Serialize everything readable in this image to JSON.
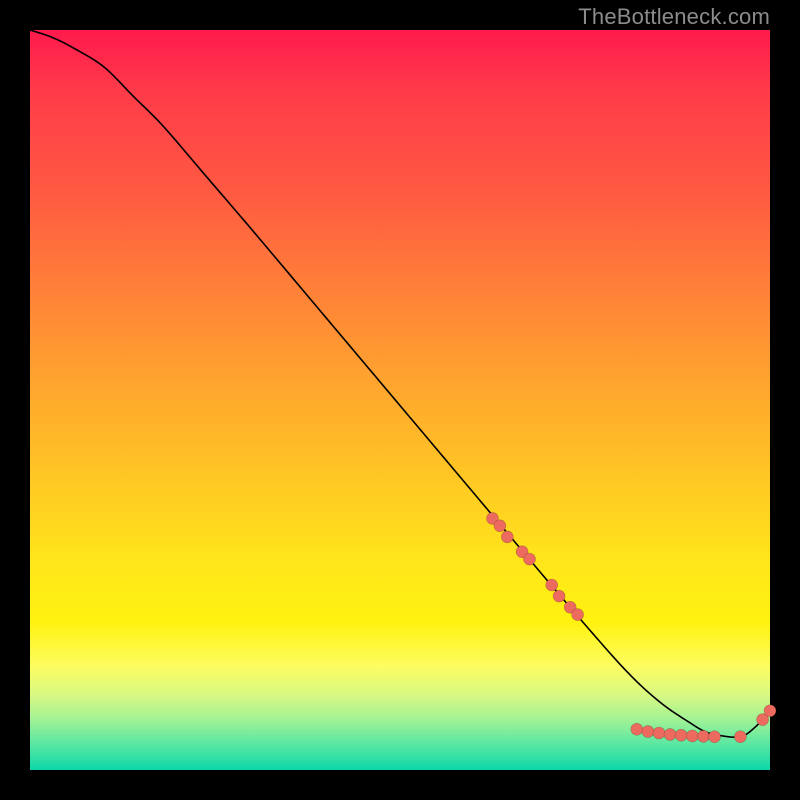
{
  "watermark": "TheBottleneck.com",
  "colors": {
    "background": "#000000",
    "curve": "#000000",
    "marker": "#ec6b5e"
  },
  "chart_data": {
    "type": "line",
    "title": "",
    "xlabel": "",
    "ylabel": "",
    "xlim": [
      0,
      100
    ],
    "ylim": [
      0,
      100
    ],
    "grid": false,
    "legend": false,
    "series": [
      {
        "name": "curve",
        "x": [
          0,
          3,
          6,
          10,
          14,
          18,
          24,
          30,
          38,
          46,
          54,
          62,
          70,
          76,
          80,
          83,
          86,
          89,
          91,
          93,
          96,
          98,
          100
        ],
        "y": [
          100,
          99,
          97.5,
          95,
          91,
          87,
          80,
          73,
          63.5,
          54,
          44.5,
          35,
          25.5,
          18.5,
          14,
          11,
          8.5,
          6.5,
          5.3,
          4.7,
          4.5,
          5.8,
          8
        ]
      }
    ],
    "markers": [
      {
        "x": 62.5,
        "y": 34
      },
      {
        "x": 63.5,
        "y": 33
      },
      {
        "x": 64.5,
        "y": 31.5
      },
      {
        "x": 66.5,
        "y": 29.5
      },
      {
        "x": 67.5,
        "y": 28.5
      },
      {
        "x": 70.5,
        "y": 25
      },
      {
        "x": 71.5,
        "y": 23.5
      },
      {
        "x": 73,
        "y": 22
      },
      {
        "x": 74,
        "y": 21
      },
      {
        "x": 82,
        "y": 5.5
      },
      {
        "x": 83.5,
        "y": 5.2
      },
      {
        "x": 85,
        "y": 5.0
      },
      {
        "x": 86.5,
        "y": 4.8
      },
      {
        "x": 88,
        "y": 4.7
      },
      {
        "x": 89.5,
        "y": 4.6
      },
      {
        "x": 91,
        "y": 4.55
      },
      {
        "x": 92.5,
        "y": 4.5
      },
      {
        "x": 96,
        "y": 4.5
      },
      {
        "x": 99,
        "y": 6.8
      },
      {
        "x": 100,
        "y": 8
      }
    ]
  }
}
